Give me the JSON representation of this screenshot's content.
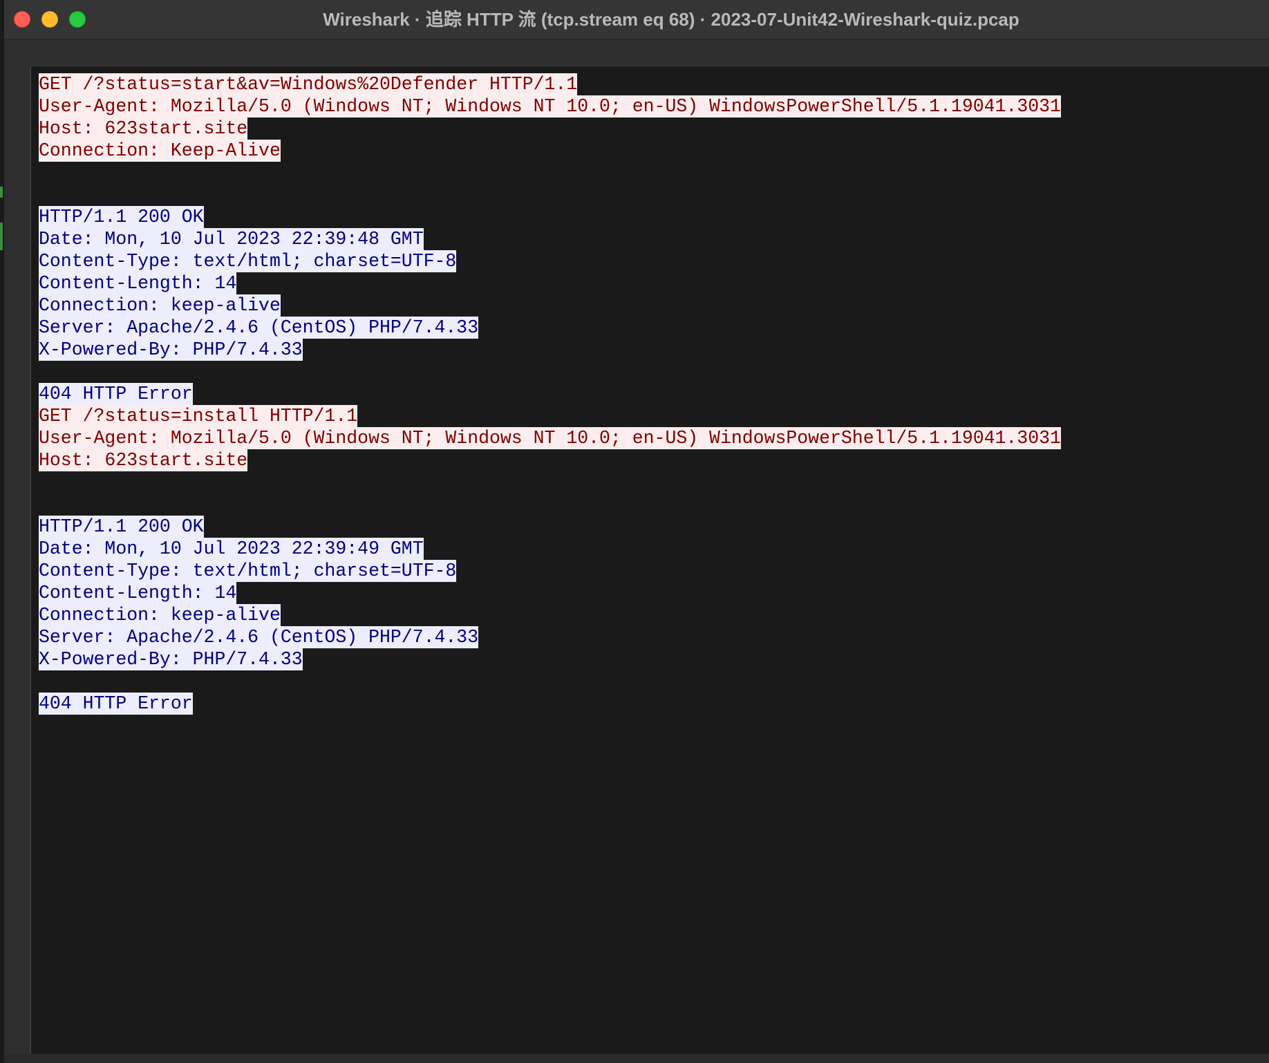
{
  "window": {
    "title": "Wireshark · 追踪 HTTP 流 (tcp.stream eq 68) · 2023-07-Unit42-Wireshark-quiz.pcap"
  },
  "stream": {
    "lines": [
      {
        "dir": "client",
        "text": "GET /?status=start&av=Windows%20Defender HTTP/1.1"
      },
      {
        "dir": "client",
        "text": "User-Agent: Mozilla/5.0 (Windows NT; Windows NT 10.0; en-US) WindowsPowerShell/5.1.19041.3031"
      },
      {
        "dir": "client",
        "text": "Host: 623start.site"
      },
      {
        "dir": "client",
        "text": "Connection: Keep-Alive"
      },
      {
        "dir": "blank",
        "text": ""
      },
      {
        "dir": "blank",
        "text": ""
      },
      {
        "dir": "server",
        "text": "HTTP/1.1 200 OK"
      },
      {
        "dir": "server",
        "text": "Date: Mon, 10 Jul 2023 22:39:48 GMT"
      },
      {
        "dir": "server",
        "text": "Content-Type: text/html; charset=UTF-8"
      },
      {
        "dir": "server",
        "text": "Content-Length: 14"
      },
      {
        "dir": "server",
        "text": "Connection: keep-alive"
      },
      {
        "dir": "server",
        "text": "Server: Apache/2.4.6 (CentOS) PHP/7.4.33"
      },
      {
        "dir": "server",
        "text": "X-Powered-By: PHP/7.4.33"
      },
      {
        "dir": "blank",
        "text": ""
      },
      {
        "dir": "server",
        "text": "404 HTTP Error"
      },
      {
        "dir": "client",
        "text": "GET /?status=install HTTP/1.1"
      },
      {
        "dir": "client",
        "text": "User-Agent: Mozilla/5.0 (Windows NT; Windows NT 10.0; en-US) WindowsPowerShell/5.1.19041.3031"
      },
      {
        "dir": "client",
        "text": "Host: 623start.site"
      },
      {
        "dir": "blank",
        "text": ""
      },
      {
        "dir": "blank",
        "text": ""
      },
      {
        "dir": "server",
        "text": "HTTP/1.1 200 OK"
      },
      {
        "dir": "server",
        "text": "Date: Mon, 10 Jul 2023 22:39:49 GMT"
      },
      {
        "dir": "server",
        "text": "Content-Type: text/html; charset=UTF-8"
      },
      {
        "dir": "server",
        "text": "Content-Length: 14"
      },
      {
        "dir": "server",
        "text": "Connection: keep-alive"
      },
      {
        "dir": "server",
        "text": "Server: Apache/2.4.6 (CentOS) PHP/7.4.33"
      },
      {
        "dir": "server",
        "text": "X-Powered-By: PHP/7.4.33"
      },
      {
        "dir": "blank",
        "text": ""
      },
      {
        "dir": "server",
        "text": "404 HTTP Error"
      }
    ]
  },
  "colors": {
    "client_bg": "#fbeded",
    "client_fg": "#7f0000",
    "server_bg": "#ededfb",
    "server_fg": "#00007f",
    "view_bg": "#1a1a1a"
  },
  "icons": {
    "close": "close-icon",
    "minimize": "minimize-icon",
    "zoom": "zoom-icon"
  }
}
